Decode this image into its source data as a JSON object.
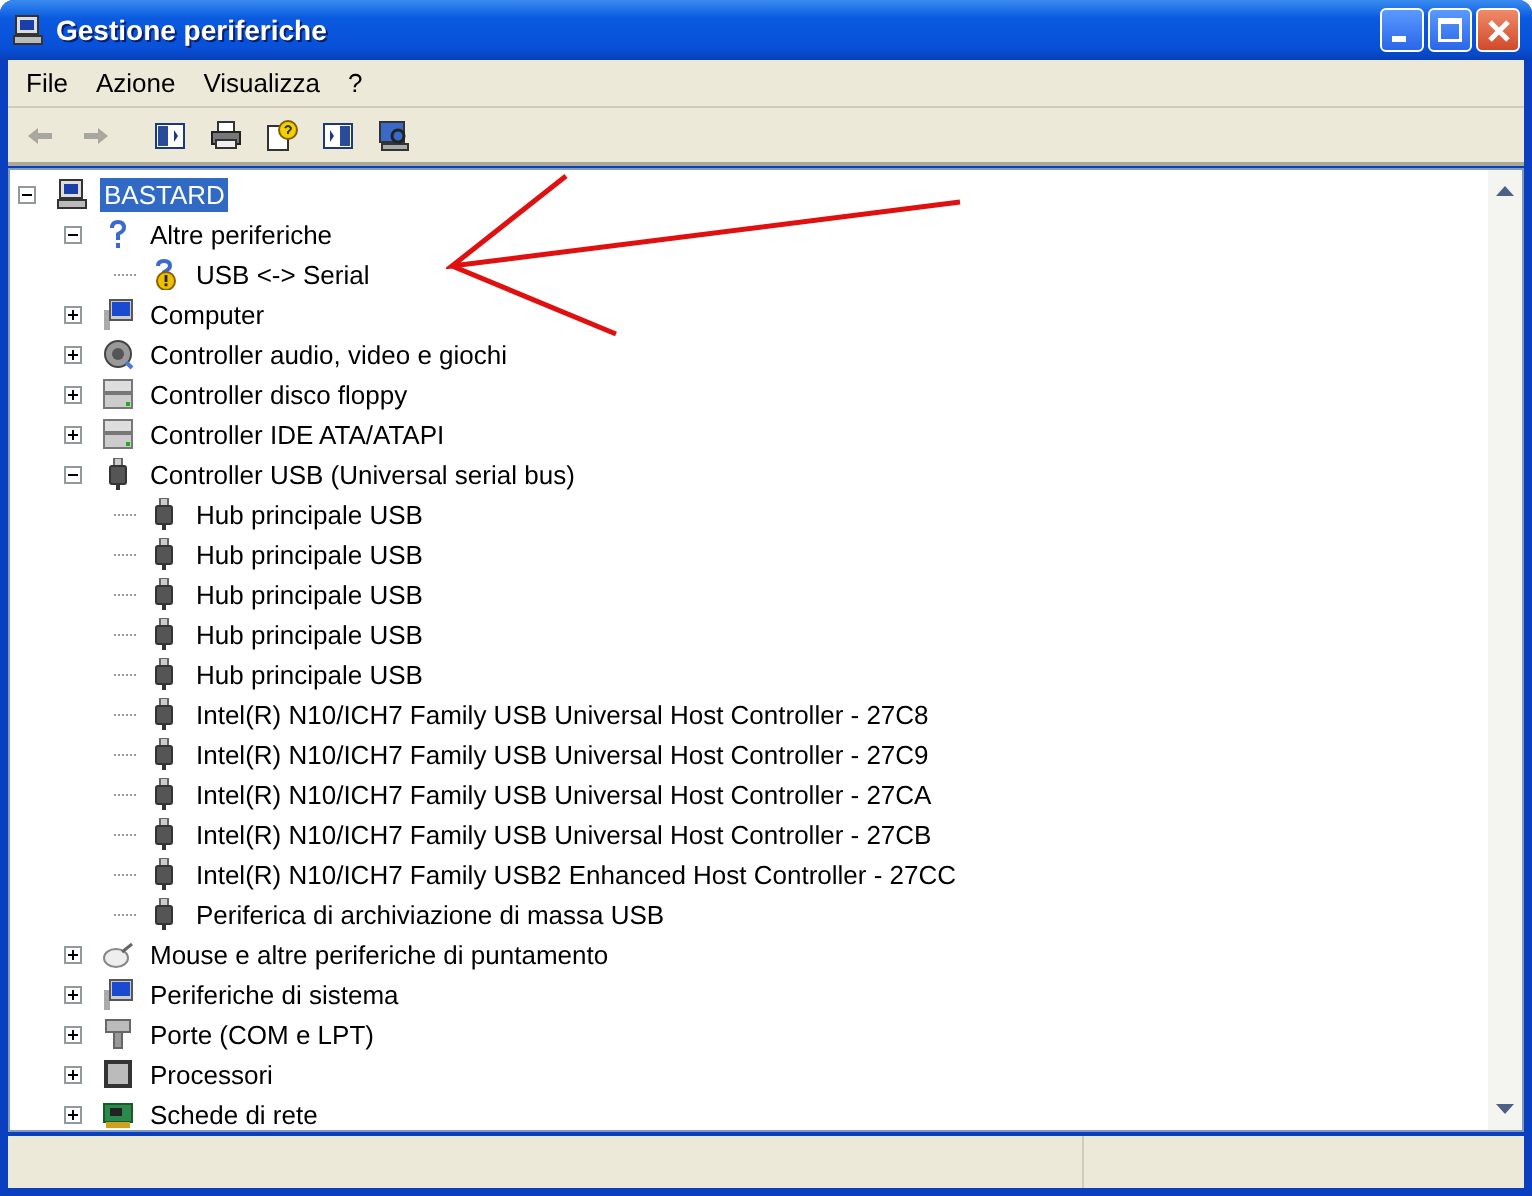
{
  "window": {
    "title": "Gestione periferiche"
  },
  "menu": [
    {
      "label": "File"
    },
    {
      "label": "Azione"
    },
    {
      "label": "Visualizza"
    },
    {
      "label": "?"
    }
  ],
  "toolbar": [
    {
      "kind": "back",
      "disabled": true
    },
    {
      "kind": "forward",
      "disabled": true
    },
    {
      "kind": "separator"
    },
    {
      "kind": "tree"
    },
    {
      "kind": "print"
    },
    {
      "kind": "help"
    },
    {
      "kind": "panel"
    },
    {
      "kind": "scan"
    }
  ],
  "tree": [
    {
      "label": "BASTARD",
      "kind": "computer",
      "selected": true,
      "expanded": true,
      "children": [
        {
          "label": "Altre periferiche",
          "kind": "unknown",
          "selected": false,
          "expanded": true,
          "children": [
            {
              "label": "USB <-> Serial",
              "kind": "unknown-warning",
              "selected": false
            }
          ]
        },
        {
          "label": "Computer",
          "kind": "monitor",
          "selected": false,
          "expanded": false
        },
        {
          "label": "Controller audio, video e giochi",
          "kind": "audio",
          "selected": false,
          "expanded": false
        },
        {
          "label": "Controller disco floppy",
          "kind": "drive",
          "selected": false,
          "expanded": false
        },
        {
          "label": "Controller IDE ATA/ATAPI",
          "kind": "drive",
          "selected": false,
          "expanded": false
        },
        {
          "label": "Controller USB (Universal serial bus)",
          "kind": "usb",
          "selected": false,
          "expanded": true,
          "children": [
            {
              "label": "Hub principale USB",
              "kind": "usb",
              "selected": false
            },
            {
              "label": "Hub principale USB",
              "kind": "usb",
              "selected": false
            },
            {
              "label": "Hub principale USB",
              "kind": "usb",
              "selected": false
            },
            {
              "label": "Hub principale USB",
              "kind": "usb",
              "selected": false
            },
            {
              "label": "Hub principale USB",
              "kind": "usb",
              "selected": false
            },
            {
              "label": "Intel(R) N10/ICH7 Family USB Universal Host Controller - 27C8",
              "kind": "usb",
              "selected": false
            },
            {
              "label": "Intel(R) N10/ICH7 Family USB Universal Host Controller - 27C9",
              "kind": "usb",
              "selected": false
            },
            {
              "label": "Intel(R) N10/ICH7 Family USB Universal Host Controller - 27CA",
              "kind": "usb",
              "selected": false
            },
            {
              "label": "Intel(R) N10/ICH7 Family USB Universal Host Controller - 27CB",
              "kind": "usb",
              "selected": false
            },
            {
              "label": "Intel(R) N10/ICH7 Family USB2 Enhanced Host Controller - 27CC",
              "kind": "usb",
              "selected": false
            },
            {
              "label": "Periferica di archiviazione di massa USB",
              "kind": "usb",
              "selected": false
            }
          ]
        },
        {
          "label": "Mouse e altre periferiche di puntamento",
          "kind": "mouse",
          "selected": false,
          "expanded": false
        },
        {
          "label": "Periferiche di sistema",
          "kind": "monitor",
          "selected": false,
          "expanded": false
        },
        {
          "label": "Porte (COM e LPT)",
          "kind": "port",
          "selected": false,
          "expanded": false
        },
        {
          "label": "Processori",
          "kind": "processor",
          "selected": false,
          "expanded": false
        },
        {
          "label": "Schede di rete",
          "kind": "network",
          "selected": false,
          "expanded": false
        }
      ]
    }
  ]
}
